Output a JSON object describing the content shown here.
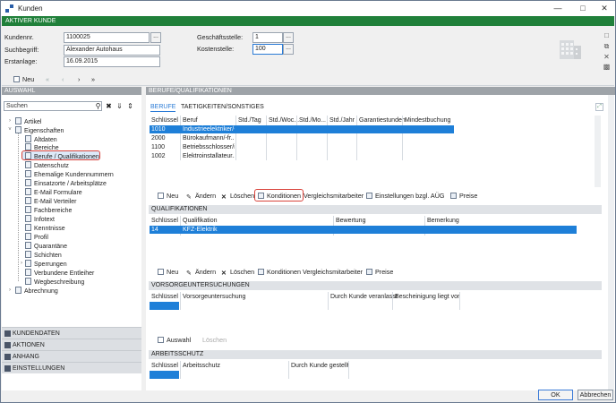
{
  "window": {
    "title": "Kunden"
  },
  "header": {
    "section": "AKTIVER KUNDE"
  },
  "form": {
    "kundennr_label": "Kundennr.",
    "kundennr_value": "1100025",
    "suchbegriff_label": "Suchbegriff:",
    "suchbegriff_value": "Alexander Autohaus",
    "erstanlage_label": "Erstanlage:",
    "erstanlage_value": "16.09.2015",
    "geschaeftsstelle_label": "Geschäftsstelle:",
    "geschaeftsstelle_value": "1",
    "kostenstelle_label": "Kostenstelle:",
    "kostenstelle_value": "100",
    "dots": "..."
  },
  "toolbar": {
    "new_label": "Neu"
  },
  "auswahl": {
    "header": "AUSWAHL",
    "search_value": "Suchen",
    "tree": [
      "Artikel",
      "Eigenschaften",
      "Altdaten",
      "Bereiche",
      "Berufe / Qualifikationen",
      "Datenschutz",
      "Ehemalige Kundennummern",
      "Einsatzorte / Arbeitsplätze",
      "E-Mail Formulare",
      "E-Mail Verteiler",
      "Fachbereiche",
      "Infotext",
      "Kenntnisse",
      "Profil",
      "Quarantäne",
      "Schichten",
      "Sperrungen",
      "Verbundene Entleiher",
      "Wegbeschreibung",
      "Abrechnung"
    ]
  },
  "bottom_nav": [
    "KUNDENDATEN",
    "AKTIONEN",
    "ANHANG",
    "EINSTELLUNGEN"
  ],
  "berufe": {
    "header": "BERUFE/QUALIFIKATIONEN",
    "tab_active": "BERUFE",
    "tab_inactive": "TAETIGKEITEN/SONSTIGES",
    "columns": [
      "Schlüssel",
      "Beruf",
      "Std./Tag",
      "Std./Woc...",
      "Std./Mo...",
      "Std./Jahr",
      "Garantiestunden",
      "Mindestbuchung"
    ],
    "rows": [
      {
        "key": "1010",
        "beruf": "Industrieelektriker/-..."
      },
      {
        "key": "2000",
        "beruf": "Bürokaufmann/-fr..."
      },
      {
        "key": "1100",
        "beruf": "Betriebsschlosser/in"
      },
      {
        "key": "1002",
        "beruf": "Elektroinstallateur..."
      }
    ],
    "actions": {
      "neu": "Neu",
      "aendern": "Ändern",
      "loeschen": "Löschen",
      "konditionen": "Konditionen",
      "vergleich": "Vergleichsmitarbeiter",
      "einstellungen": "Einstellungen bzgl. AÜG",
      "preise": "Preise"
    }
  },
  "qualifikationen": {
    "header": "QUALIFIKATIONEN",
    "columns": [
      "Schlüssel",
      "Qualifikation",
      "Bewertung",
      "Bemerkung"
    ],
    "rows": [
      {
        "key": "14",
        "name": "KFZ-Elektrik"
      }
    ],
    "actions": {
      "neu": "Neu",
      "aendern": "Ändern",
      "loeschen": "Löschen",
      "konditionen_vergleich": "Konditionen Vergleichsmitarbeiter",
      "preise": "Preise"
    }
  },
  "vorsorge": {
    "header": "VORSORGEUNTERSUCHUNGEN",
    "columns": [
      "Schlüssel",
      "Vorsorgeuntersuchung",
      "Durch Kunde veranlasst",
      "Bescheinigung liegt vor"
    ],
    "actions": {
      "auswahl": "Auswahl",
      "loeschen": "Löschen"
    }
  },
  "arbeitsschutz": {
    "header": "ARBEITSSCHUTZ",
    "columns": [
      "Schlüssel",
      "Arbeitsschutz",
      "Durch Kunde gestellt"
    ]
  },
  "footer": {
    "ok": "OK",
    "abbrechen": "Abbrechen"
  }
}
